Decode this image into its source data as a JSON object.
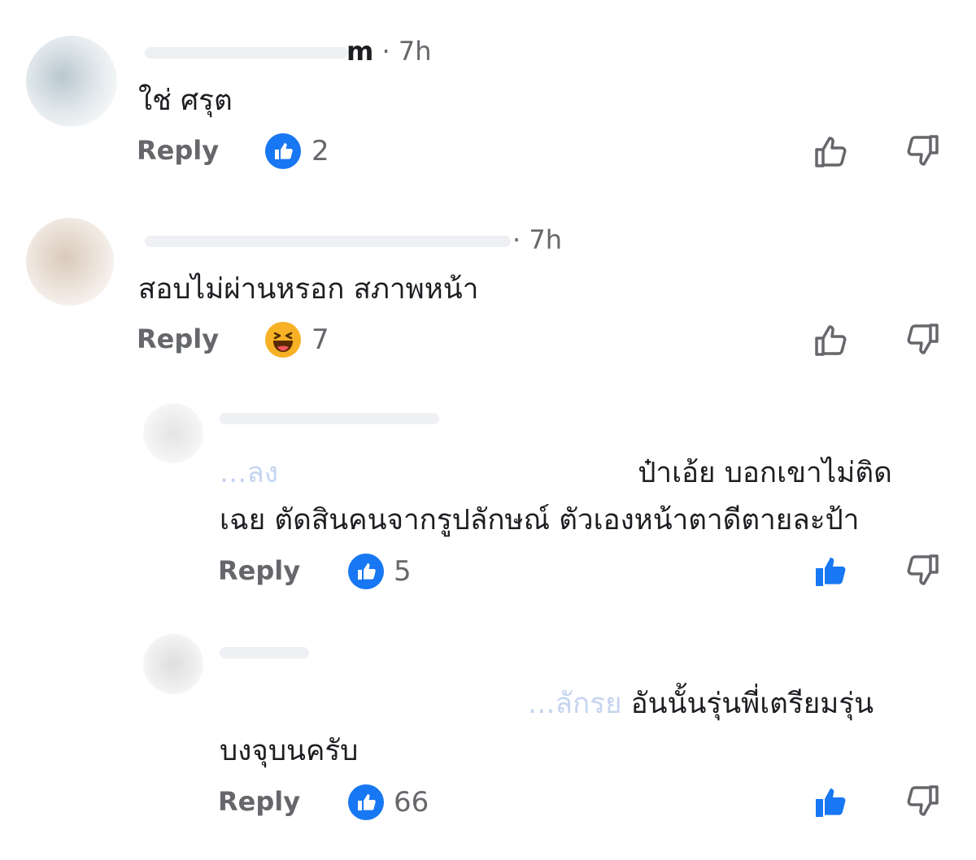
{
  "comments": [
    {
      "name_fragment": "m",
      "time_sep": "·",
      "time": "7h",
      "text": "ใช่ ศรุต",
      "reply_label": "Reply",
      "reaction_icon": "like-icon",
      "reaction_count": "2",
      "liked": false
    },
    {
      "name_fragment": "",
      "time_sep": "·",
      "time": "7h",
      "text": "สอบไม่ผ่านหรอก สภาพหน้า",
      "reply_label": "Reply",
      "reaction_icon": "haha-icon",
      "reaction_count": "7",
      "liked": false
    },
    {
      "mention_fragment": "...ลง",
      "text_line1": "ป๋าเอ้ย บอกเขาไม่ติด",
      "text_line2": "เฉย ตัดสินคนจากรูปลักษณ์ ตัวเองหน้าตาดีตายละป้า",
      "reply_label": "Reply",
      "reaction_icon": "like-icon",
      "reaction_count": "5",
      "liked": true
    },
    {
      "mention_fragment": "...ลักรย",
      "text_line1": "อันนั้นรุ่นพี่เตรียมรุ่น",
      "text_line2": "บงจุบนครับ",
      "reply_label": "Reply",
      "reaction_icon": "like-icon",
      "reaction_count": "66",
      "liked": true
    }
  ],
  "colors": {
    "like_blue": "#1877f2",
    "muted_text": "#65676b",
    "haha_yellow": "#f7b125"
  }
}
